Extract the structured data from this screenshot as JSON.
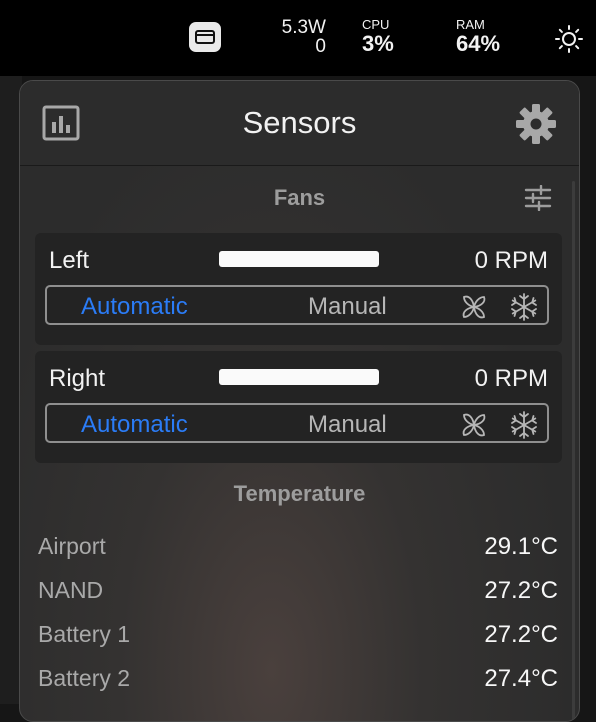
{
  "menubar": {
    "power_top": "5.3W",
    "power_bottom": "0",
    "cpu_label": "CPU",
    "cpu_value": "3%",
    "ram_label": "RAM",
    "ram_value": "64%"
  },
  "panel": {
    "title": "Sensors",
    "fans_section": "Fans",
    "temperature_section": "Temperature"
  },
  "fans": [
    {
      "name": "Left",
      "rpm": "0 RPM",
      "mode_auto": "Automatic",
      "mode_manual": "Manual",
      "selected_mode": "Automatic"
    },
    {
      "name": "Right",
      "rpm": "0 RPM",
      "mode_auto": "Automatic",
      "mode_manual": "Manual",
      "selected_mode": "Automatic"
    }
  ],
  "temperatures": [
    {
      "name": "Airport",
      "value": "29.1°C"
    },
    {
      "name": "NAND",
      "value": "27.2°C"
    },
    {
      "name": "Battery 1",
      "value": "27.2°C"
    },
    {
      "name": "Battery 2",
      "value": "27.4°C"
    }
  ],
  "icons": {
    "app": "window-icon",
    "brightness": "sun-icon",
    "stats": "bar-chart-icon",
    "settings": "gear-icon",
    "fan_settings": "sliders-icon",
    "fan_mode": "fan-icon",
    "cool_mode": "snowflake-icon"
  },
  "colors": {
    "accent": "#2b7cf6",
    "menubar_bg": "#000000",
    "panel_bg": "#2c2c2c"
  }
}
